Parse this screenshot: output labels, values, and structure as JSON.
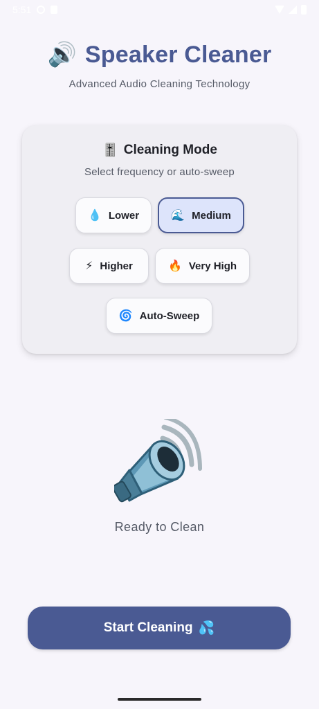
{
  "status_bar": {
    "time": "5:51"
  },
  "header": {
    "icon": "🔊",
    "title": "Speaker Cleaner",
    "subtitle": "Advanced Audio Cleaning Technology"
  },
  "mode_card": {
    "icon": "🎚️",
    "title": "Cleaning Mode",
    "subtitle": "Select frequency or auto-sweep",
    "selected": "Medium",
    "modes": [
      {
        "emoji": "💧",
        "label": "Lower"
      },
      {
        "emoji": "🌊",
        "label": "Medium"
      },
      {
        "emoji": "⚡",
        "label": "Higher"
      },
      {
        "emoji": "🔥",
        "label": "Very High"
      },
      {
        "emoji": "🌀",
        "label": "Auto-Sweep"
      }
    ]
  },
  "speaker": {
    "icon": "speaker-megaphone-icon",
    "status": "Ready to Clean"
  },
  "start_button": {
    "label": "Start Cleaning",
    "emoji": "💦"
  },
  "colors": {
    "accent": "#4a5a93",
    "background": "#f7f5fb",
    "card": "#efeef3",
    "selected_bg": "#dde4fb"
  }
}
